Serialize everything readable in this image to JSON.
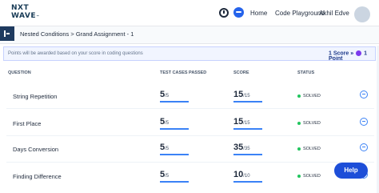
{
  "logo": {
    "line1": "NXT",
    "line2": "WAVE",
    "suffix": "™"
  },
  "nav": {
    "home": "Home",
    "code_playground": "Code Playground",
    "user_name": "Akhil Edve"
  },
  "breadcrumb": {
    "text": "Nested Conditions > Grand Assignment - 1"
  },
  "info": {
    "message": "Points will be awarded based on your score in coding questions",
    "score_rule": "1 Score",
    "arrow": "»",
    "points_rule": "1 Point"
  },
  "table": {
    "headers": {
      "question": "QUESTION",
      "test_cases": "TEST CASES PASSED",
      "score": "SCORE",
      "status": "STATUS"
    },
    "rows": [
      {
        "name": "String Repetition",
        "tc_value": "5",
        "tc_total": "/5",
        "score_value": "15",
        "score_total": "/15",
        "status": "SOLVED"
      },
      {
        "name": "First Place",
        "tc_value": "5",
        "tc_total": "/5",
        "score_value": "15",
        "score_total": "/15",
        "status": "SOLVED"
      },
      {
        "name": "Days Conversion",
        "tc_value": "5",
        "tc_total": "/5",
        "score_value": "35",
        "score_total": "/35",
        "status": "SOLVED"
      },
      {
        "name": "Finding Difference",
        "tc_value": "5",
        "tc_total": "/5",
        "score_value": "10",
        "score_total": "/10",
        "status": "SOLVED"
      }
    ]
  },
  "help_button": "Help",
  "colors": {
    "accent": "#1d4ed8",
    "solved": "#22c55e",
    "badge": "#7c3aed"
  }
}
